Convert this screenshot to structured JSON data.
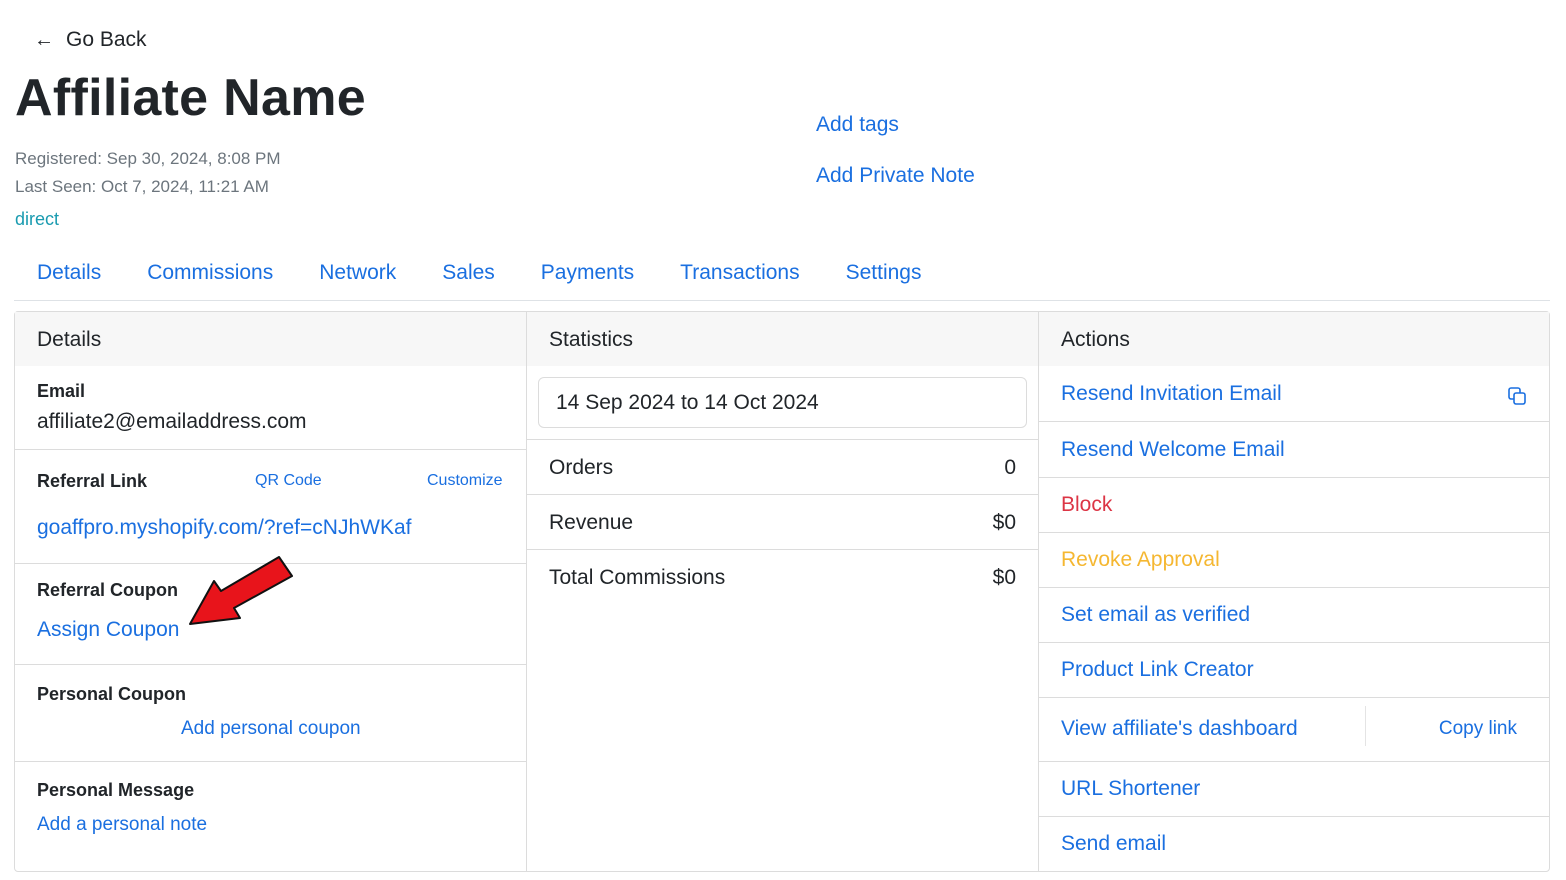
{
  "nav": {
    "back_label": "Go Back"
  },
  "affiliate": {
    "name": "Affiliate Name",
    "registered": "Registered: Sep 30, 2024, 8:08 PM",
    "last_seen": "Last Seen: Oct 7, 2024, 11:21 AM",
    "source": "direct",
    "add_tags": "Add tags",
    "add_private_note": "Add Private Note"
  },
  "tabs": [
    "Details",
    "Commissions",
    "Network",
    "Sales",
    "Payments",
    "Transactions",
    "Settings"
  ],
  "details": {
    "header": "Details",
    "email_label": "Email",
    "email_value": "affiliate2@emailaddress.com",
    "referral_link_label": "Referral Link",
    "qr_code": "QR Code",
    "customize": "Customize",
    "referral_link_value": "goaffpro.myshopify.com/?ref=cNJhWKaf",
    "referral_coupon_label": "Referral Coupon",
    "assign_coupon": "Assign Coupon",
    "personal_coupon_label": "Personal Coupon",
    "add_personal_coupon": "Add personal coupon",
    "personal_message_label": "Personal Message",
    "add_personal_note": "Add a personal note"
  },
  "statistics": {
    "header": "Statistics",
    "date_range": "14 Sep 2024 to 14 Oct 2024",
    "rows": [
      {
        "label": "Orders",
        "value": "0"
      },
      {
        "label": "Revenue",
        "value": "$0"
      },
      {
        "label": "Total Commissions",
        "value": "$0"
      }
    ]
  },
  "actions": {
    "header": "Actions",
    "resend_invitation": "Resend Invitation Email",
    "resend_welcome": "Resend Welcome Email",
    "block": "Block",
    "revoke_approval": "Revoke Approval",
    "set_verified": "Set email as verified",
    "product_link_creator": "Product Link Creator",
    "view_dashboard": "View affiliate's dashboard",
    "copy_link": "Copy link",
    "url_shortener": "URL Shortener",
    "send_email": "Send email"
  },
  "colors": {
    "link": "#1a6fe0",
    "danger": "#dc3545",
    "warning": "#f5b731",
    "info": "#1a9bb0",
    "annotation_arrow": "#e8141b"
  },
  "icons": {
    "back": "arrow-left-icon",
    "copy": "copy-icon"
  }
}
